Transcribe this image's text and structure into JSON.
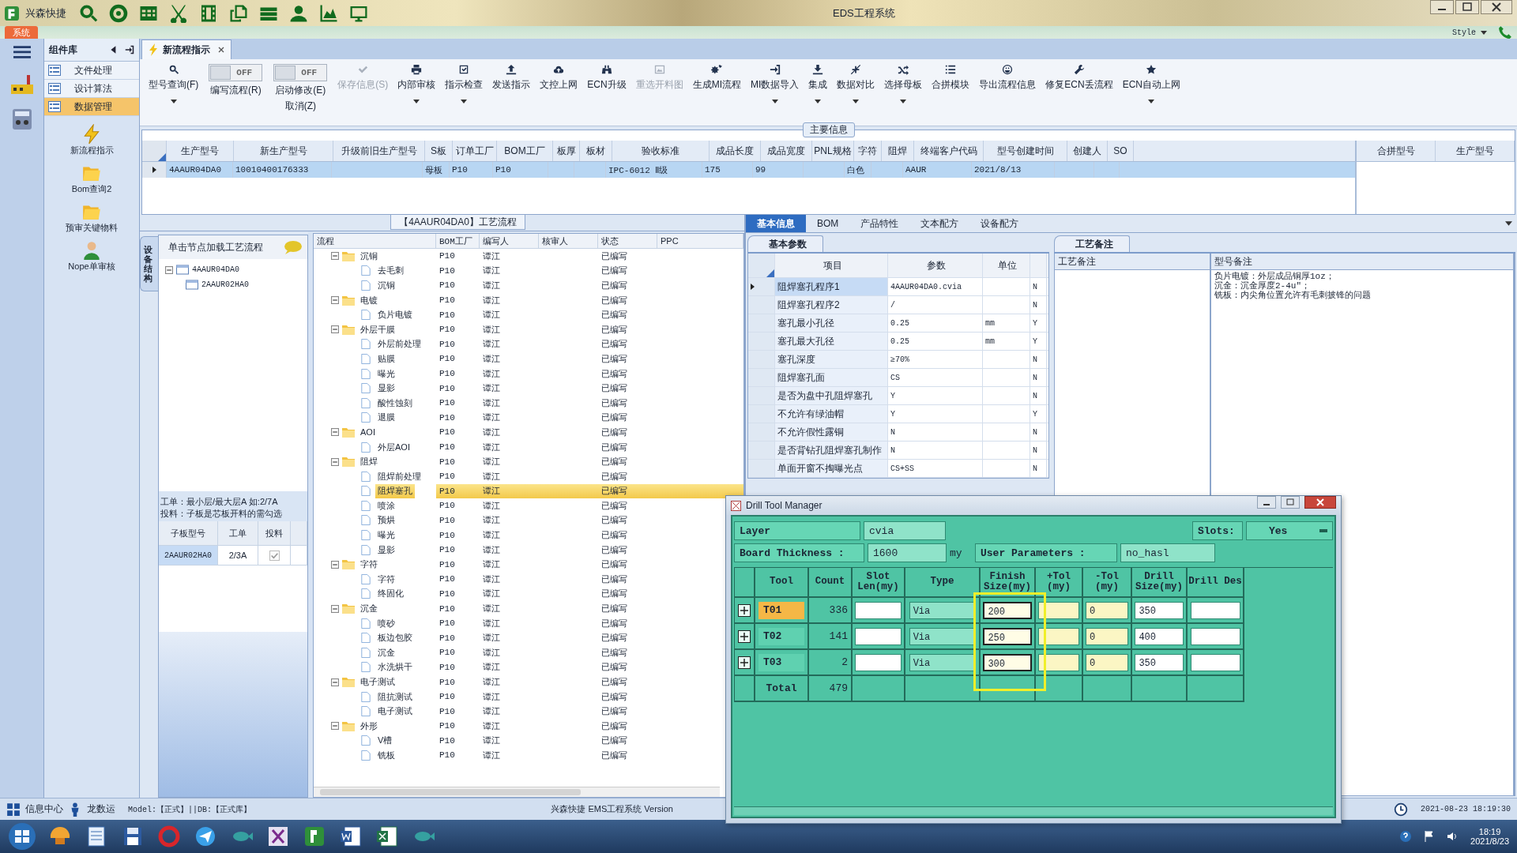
{
  "app": {
    "title": "兴森快捷",
    "window_title": "EDS工程系统",
    "menu_tab": "系统",
    "style_menu": "Style"
  },
  "sidebar": {
    "title": "组件库",
    "items": [
      {
        "label": "文件处理",
        "selected": false
      },
      {
        "label": "设计算法",
        "selected": false
      },
      {
        "label": "数据管理",
        "selected": true
      }
    ],
    "tools": [
      "新流程指示",
      "Bom查询2",
      "预审关键物料",
      "Nope单审核"
    ]
  },
  "tabs": [
    {
      "label": "新流程指示",
      "selected": true
    }
  ],
  "toolbar": [
    {
      "kind": "button",
      "label": "型号查询(F)",
      "disabled": false,
      "dropdown": true
    },
    {
      "kind": "toggle",
      "label": "编写流程(R)",
      "switch": "OFF",
      "on": false
    },
    {
      "kind": "toggle",
      "label": "启动修改(E)",
      "sublabel": "取消(Z)",
      "switch": "OFF",
      "on": false
    },
    {
      "kind": "button",
      "label": "保存信息(S)",
      "disabled": true,
      "dropdown": false
    },
    {
      "kind": "button",
      "label": "内部审核",
      "disabled": false,
      "dropdown": true
    },
    {
      "kind": "button",
      "label": "指示检查",
      "disabled": false,
      "dropdown": true
    },
    {
      "kind": "button",
      "label": "发送指示",
      "disabled": false,
      "dropdown": false
    },
    {
      "kind": "button",
      "label": "文控上网",
      "disabled": false,
      "dropdown": false
    },
    {
      "kind": "button",
      "label": "ECN升级",
      "disabled": false,
      "dropdown": false
    },
    {
      "kind": "button",
      "label": "重选开料图",
      "disabled": true,
      "dropdown": false
    },
    {
      "kind": "button",
      "label": "生成MI流程",
      "disabled": false,
      "dropdown": false
    },
    {
      "kind": "button",
      "label": "MI数据导入",
      "disabled": false,
      "dropdown": true
    },
    {
      "kind": "button",
      "label": "集成",
      "disabled": false,
      "dropdown": true
    },
    {
      "kind": "button",
      "label": "数据对比",
      "disabled": false,
      "dropdown": true
    },
    {
      "kind": "button",
      "label": "选择母板",
      "disabled": false,
      "dropdown": true
    },
    {
      "kind": "button",
      "label": "合拼模块",
      "disabled": false,
      "dropdown": false
    },
    {
      "kind": "button",
      "label": "导出流程信息",
      "disabled": false,
      "dropdown": false
    },
    {
      "kind": "button",
      "label": "修复ECN丢流程",
      "disabled": false,
      "dropdown": false
    },
    {
      "kind": "button",
      "label": "ECN自动上网",
      "disabled": false,
      "dropdown": true
    }
  ],
  "main_info": {
    "title": "主要信息",
    "columns": [
      "生产型号",
      "新生产型号",
      "升级前旧生产型号",
      "S板",
      "订单工厂",
      "BOM工厂",
      "板厚",
      "板材",
      "验收标准",
      "成品长度",
      "成品宽度",
      "PNL规格",
      "字符",
      "阻焊",
      "终端客户代码",
      "型号创建时间",
      "创建人",
      "SO"
    ],
    "rows": [
      {
        "selected": true,
        "cells": [
          "4AAUR04DA0",
          "10010400176333",
          "",
          "母板",
          "P10",
          "P10",
          "",
          "",
          "IPC-6012 Ⅱ级",
          "175",
          "99",
          "",
          "白色",
          "",
          "AAUR",
          "2021/8/13",
          "",
          ""
        ]
      }
    ],
    "merge_columns": [
      "合拼型号",
      "生产型号"
    ]
  },
  "structure": {
    "side_tab": "设备结构",
    "hint": "单击节点加载工艺流程",
    "tree": [
      {
        "label": "4AAUR04DA0",
        "expanded": true,
        "children": [
          {
            "label": "2AAUR02HA0"
          }
        ]
      }
    ],
    "note": [
      "工单：最小层/最大层A 如:2/7A",
      "投料：子板是芯板开料的需勾选"
    ],
    "columns": [
      "子板型号",
      "工单",
      "投料"
    ],
    "rows": [
      {
        "board": "2AAUR02HA0",
        "order": "2/3A",
        "checked": true
      }
    ]
  },
  "process": {
    "title": "【4AAUR04DA0】工艺流程",
    "columns": [
      "流程",
      "BOM工厂",
      "编写人",
      "核审人",
      "状态",
      "PPC"
    ],
    "nodes": [
      {
        "kind": "folder",
        "name": "沉铜",
        "factory": "P10",
        "writer": "谭江",
        "status": "已编写",
        "selected": false,
        "expanded": true,
        "children": [
          {
            "kind": "step",
            "name": "去毛刺",
            "factory": "P10",
            "writer": "谭江",
            "status": "已编写",
            "selected": false
          },
          {
            "kind": "step",
            "name": "沉铜",
            "factory": "P10",
            "writer": "谭江",
            "status": "已编写",
            "selected": false
          }
        ]
      },
      {
        "kind": "folder",
        "name": "电镀",
        "factory": "P10",
        "writer": "谭江",
        "status": "已编写",
        "selected": false,
        "expanded": true,
        "children": [
          {
            "kind": "step",
            "name": "负片电镀",
            "factory": "P10",
            "writer": "谭江",
            "status": "已编写",
            "selected": false
          }
        ]
      },
      {
        "kind": "folder",
        "name": "外层干膜",
        "factory": "P10",
        "writer": "谭江",
        "status": "已编写",
        "selected": false,
        "expanded": true,
        "children": [
          {
            "kind": "step",
            "name": "外层前处理",
            "factory": "P10",
            "writer": "谭江",
            "status": "已编写",
            "selected": false
          },
          {
            "kind": "step",
            "name": "贴膜",
            "factory": "P10",
            "writer": "谭江",
            "status": "已编写",
            "selected": false
          },
          {
            "kind": "step",
            "name": "曝光",
            "factory": "P10",
            "writer": "谭江",
            "status": "已编写",
            "selected": false
          },
          {
            "kind": "step",
            "name": "显影",
            "factory": "P10",
            "writer": "谭江",
            "status": "已编写",
            "selected": false
          },
          {
            "kind": "step",
            "name": "酸性蚀刻",
            "factory": "P10",
            "writer": "谭江",
            "status": "已编写",
            "selected": false
          },
          {
            "kind": "step",
            "name": "退膜",
            "factory": "P10",
            "writer": "谭江",
            "status": "已编写",
            "selected": false
          }
        ]
      },
      {
        "kind": "folder",
        "name": "AOI",
        "factory": "P10",
        "writer": "谭江",
        "status": "已编写",
        "selected": false,
        "expanded": true,
        "children": [
          {
            "kind": "step",
            "name": "外层AOI",
            "factory": "P10",
            "writer": "谭江",
            "status": "已编写",
            "selected": false
          }
        ]
      },
      {
        "kind": "folder",
        "name": "阻焊",
        "factory": "P10",
        "writer": "谭江",
        "status": "已编写",
        "selected": false,
        "expanded": true,
        "children": [
          {
            "kind": "step",
            "name": "阻焊前处理",
            "factory": "P10",
            "writer": "谭江",
            "status": "已编写",
            "selected": false
          },
          {
            "kind": "step",
            "name": "阻焊塞孔",
            "factory": "P10",
            "writer": "谭江",
            "status": "已编写",
            "selected": true
          },
          {
            "kind": "step",
            "name": "喷涂",
            "factory": "P10",
            "writer": "谭江",
            "status": "已编写",
            "selected": false
          },
          {
            "kind": "step",
            "name": "预烘",
            "factory": "P10",
            "writer": "谭江",
            "status": "已编写",
            "selected": false
          },
          {
            "kind": "step",
            "name": "曝光",
            "factory": "P10",
            "writer": "谭江",
            "status": "已编写",
            "selected": false
          },
          {
            "kind": "step",
            "name": "显影",
            "factory": "P10",
            "writer": "谭江",
            "status": "已编写",
            "selected": false
          }
        ]
      },
      {
        "kind": "folder",
        "name": "字符",
        "factory": "P10",
        "writer": "谭江",
        "status": "已编写",
        "selected": false,
        "expanded": true,
        "children": [
          {
            "kind": "step",
            "name": "字符",
            "factory": "P10",
            "writer": "谭江",
            "status": "已编写",
            "selected": false
          },
          {
            "kind": "step",
            "name": "终固化",
            "factory": "P10",
            "writer": "谭江",
            "status": "已编写",
            "selected": false
          }
        ]
      },
      {
        "kind": "folder",
        "name": "沉金",
        "factory": "P10",
        "writer": "谭江",
        "status": "已编写",
        "selected": false,
        "expanded": true,
        "children": [
          {
            "kind": "step",
            "name": "喷砂",
            "factory": "P10",
            "writer": "谭江",
            "status": "已编写",
            "selected": false
          },
          {
            "kind": "step",
            "name": "板边包胶",
            "factory": "P10",
            "writer": "谭江",
            "status": "已编写",
            "selected": false
          },
          {
            "kind": "step",
            "name": "沉金",
            "factory": "P10",
            "writer": "谭江",
            "status": "已编写",
            "selected": false
          },
          {
            "kind": "step",
            "name": "水洗烘干",
            "factory": "P10",
            "writer": "谭江",
            "status": "已编写",
            "selected": false
          }
        ]
      },
      {
        "kind": "folder",
        "name": "电子测试",
        "factory": "P10",
        "writer": "谭江",
        "status": "已编写",
        "selected": false,
        "expanded": true,
        "children": [
          {
            "kind": "step",
            "name": "阻抗测试",
            "factory": "P10",
            "writer": "谭江",
            "status": "已编写",
            "selected": false
          },
          {
            "kind": "step",
            "name": "电子测试",
            "factory": "P10",
            "writer": "谭江",
            "status": "已编写",
            "selected": false
          }
        ]
      },
      {
        "kind": "folder",
        "name": "外形",
        "factory": "P10",
        "writer": "谭江",
        "status": "已编写",
        "selected": false,
        "expanded": true,
        "children": [
          {
            "kind": "step",
            "name": "V槽",
            "factory": "P10",
            "writer": "谭江",
            "status": "已编写",
            "selected": false
          },
          {
            "kind": "step",
            "name": "铣板",
            "factory": "P10",
            "writer": "谭江",
            "status": "已编写",
            "selected": false
          }
        ]
      }
    ]
  },
  "info_tabs": [
    {
      "label": "基本信息",
      "selected": true
    },
    {
      "label": "BOM",
      "selected": false
    },
    {
      "label": "产品特性",
      "selected": false
    },
    {
      "label": "文本配方",
      "selected": false
    },
    {
      "label": "设备配方",
      "selected": false
    }
  ],
  "params": {
    "tab": "基本参数",
    "columns": [
      "项目",
      "参数",
      "单位"
    ],
    "rows": [
      {
        "item": "阻焊塞孔程序1",
        "value": "4AAUR04DA0.cvia",
        "unit": "",
        "flag": "N",
        "selected": true
      },
      {
        "item": "阻焊塞孔程序2",
        "value": "/",
        "unit": "",
        "flag": "N",
        "selected": false
      },
      {
        "item": "塞孔最小孔径",
        "value": "0.25",
        "unit": "mm",
        "flag": "Y",
        "selected": false
      },
      {
        "item": "塞孔最大孔径",
        "value": "0.25",
        "unit": "mm",
        "flag": "Y",
        "selected": false
      },
      {
        "item": "塞孔深度",
        "value": "≥70%",
        "unit": "",
        "flag": "N",
        "selected": false
      },
      {
        "item": "阻焊塞孔面",
        "value": "CS",
        "unit": "",
        "flag": "N",
        "selected": false
      },
      {
        "item": "是否为盘中孔阻焊塞孔",
        "value": "Y",
        "unit": "",
        "flag": "N",
        "selected": false
      },
      {
        "item": "不允许有绿油帽",
        "value": "Y",
        "unit": "",
        "flag": "Y",
        "selected": false
      },
      {
        "item": "不允许假性露铜",
        "value": "N",
        "unit": "",
        "flag": "N",
        "selected": false
      },
      {
        "item": "是否背钻孔阻焊塞孔制作",
        "value": "N",
        "unit": "",
        "flag": "N",
        "selected": false
      },
      {
        "item": "单面开窗不掏曝光点",
        "value": "CS+SS",
        "unit": "",
        "flag": "N",
        "selected": false
      }
    ]
  },
  "remarks": {
    "tab": "工艺备注",
    "columns": [
      "工艺备注",
      "型号备注"
    ],
    "model_notes": [
      "负片电镀：外层成品铜厚1oz；",
      "沉金：沉金厚度2-4u\"；",
      "铣板：内尖角位置允许有毛刺披锋的问题"
    ]
  },
  "drill": {
    "title": "Drill Tool Manager",
    "layer_label": "Layer",
    "layer": "cvia",
    "slots_label": "Slots:",
    "slots": "Yes",
    "thickness_label": "Board Thickness :",
    "thickness": "1600",
    "thickness_unit": "my",
    "params_label": "User Parameters :",
    "params": "no_hasl",
    "columns": [
      "Tool",
      "Count",
      "Slot Len(my)",
      "Type",
      "Finish Size(my)",
      "+Tol (my)",
      "-Tol (my)",
      "Drill Size(my)",
      "Drill Des"
    ],
    "rows": [
      {
        "tool": "T01",
        "count": "336",
        "type": "Via",
        "finish": "200",
        "minus_tol": "0",
        "drill_size": "350",
        "selected": true
      },
      {
        "tool": "T02",
        "count": "141",
        "type": "Via",
        "finish": "250",
        "minus_tol": "0",
        "drill_size": "400",
        "selected": false
      },
      {
        "tool": "T03",
        "count": "2",
        "type": "Via",
        "finish": "300",
        "minus_tol": "0",
        "drill_size": "350",
        "selected": false
      }
    ],
    "total_label": "Total",
    "total_count": "479"
  },
  "status_bar": {
    "info": "信息中心",
    "user": "龙数运",
    "model": "Model:【正式】||DB:【正式库】",
    "product": "兴森快捷 EMS工程系统 Version",
    "datetime": "2021-08-23 18:19:30"
  },
  "taskbar": {
    "time": "18:19",
    "date": "2021/8/23"
  }
}
